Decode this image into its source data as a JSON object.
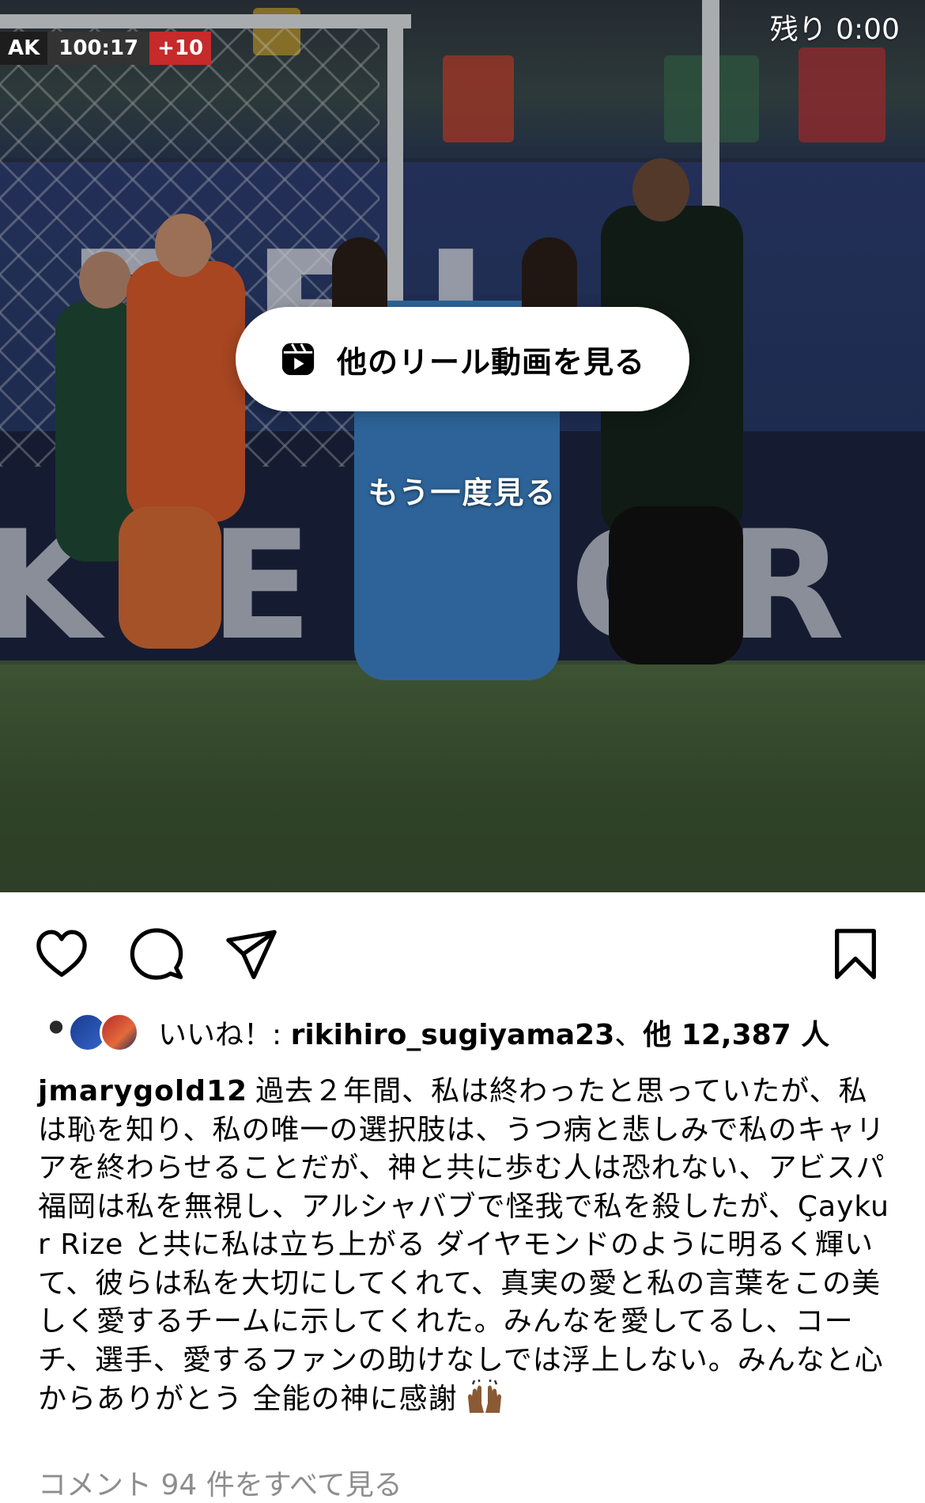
{
  "video": {
    "time_remaining": "残り 0:00",
    "scoreboard": {
      "team": "AK",
      "clock": "100:17",
      "added_time": "+10"
    },
    "banner_top_text": "ZEL",
    "banner_text": "K'E POR B",
    "reels_button_label": "他のリール動画を見る",
    "replay_label": "もう一度見る",
    "reels_icon": "reels-icon"
  },
  "actions": {
    "like_icon": "heart-icon",
    "comment_icon": "comment-icon",
    "share_icon": "share-icon",
    "save_icon": "bookmark-icon"
  },
  "likes": {
    "prefix": "いいね！: ",
    "user": "rikihiro_sugiyama23",
    "separator": "、",
    "others": "他 12,387 人"
  },
  "caption": {
    "username": "jmarygold12",
    "text": "過去２年間、私は終わったと思っていたが、私は恥を知り、私の唯一の選択肢は、うつ病と悲しみで私のキャリアを終わらせることだが、神と共に歩む人は恐れない、アビスパ福岡は私を無視し、アルシャバブで怪我で私を殺したが、Çaykur Rize と共に私は立ち上がる ダイヤモンドのように明るく輝いて、彼らは私を大切にしてくれて、真実の愛と私の言葉をこの美しく愛するチームに示してくれた。みんなを愛してるし、コーチ、選手、愛するファンの助けなしでは浮上しない。みんなと心からありがとう 全能の神に感謝",
    "emoji_icon": "raised-hands-icon"
  },
  "comments_link": "コメント 94 件をすべて見る",
  "colors": {
    "background": "#ffffff",
    "text": "#000000",
    "muted": "#8e8e8e",
    "scoreboard_added": "#c62a2a"
  }
}
